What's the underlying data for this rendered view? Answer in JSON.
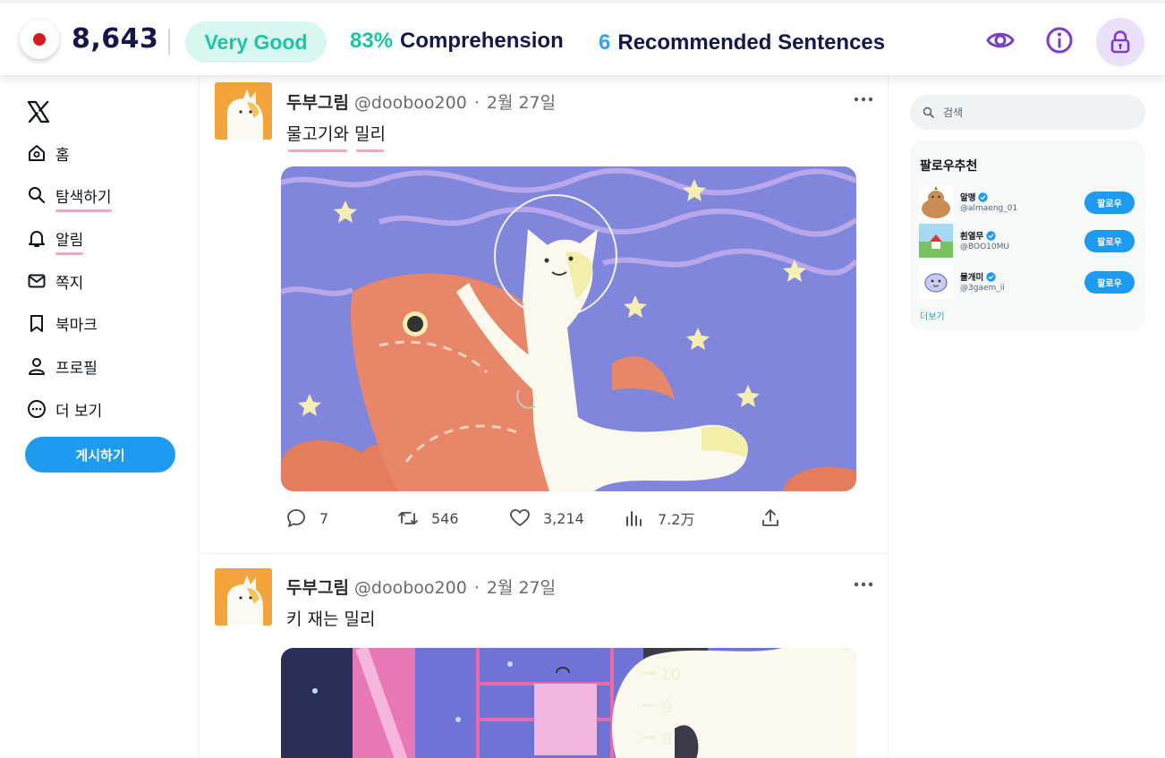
{
  "topbar": {
    "score": "8,643",
    "level": "Very Good",
    "comprehension_pct": "83%",
    "comprehension_label": "Comprehension",
    "recommended_count": "6",
    "recommended_label": "Recommended Sentences",
    "colors": {
      "accent_teal": "#1dc6a2",
      "navy": "#17154a",
      "purple": "#7b3fc4",
      "flag_red": "#d71920"
    },
    "icons": [
      "korea-flag-icon",
      "eye-icon",
      "info-icon",
      "lock-icon"
    ]
  },
  "sidebar": {
    "logo": "x-logo-icon",
    "items": [
      {
        "label": "홈",
        "icon": "home-icon"
      },
      {
        "label": "탐색하기",
        "icon": "search-icon"
      },
      {
        "label": "알림",
        "icon": "bell-icon"
      },
      {
        "label": "쪽지",
        "icon": "mail-icon"
      },
      {
        "label": "북마크",
        "icon": "bookmark-icon"
      },
      {
        "label": "프로필",
        "icon": "profile-icon"
      },
      {
        "label": "더 보기",
        "icon": "more-circle-icon"
      }
    ],
    "post_button": "게시하기"
  },
  "feed": {
    "tweets": [
      {
        "author": "두부그림",
        "handle": "@dooboo200",
        "dot": "·",
        "date": "2월 27일",
        "text_words": [
          "물고기와",
          "밀리"
        ],
        "replies": "7",
        "retweets": "546",
        "likes": "3,214",
        "views": "7.2万"
      },
      {
        "author": "두부그림",
        "handle": "@dooboo200",
        "dot": "·",
        "date": "2월 27일",
        "text": "키 재는 밀리",
        "ruler_marks": [
          "10",
          "9",
          "8"
        ]
      }
    ]
  },
  "right": {
    "search_placeholder": "검색",
    "who_to_follow": {
      "title": "팔로우추천",
      "accounts": [
        {
          "name": "알맹",
          "handle": "@almaeng_01",
          "button": "팔로우",
          "verified": true
        },
        {
          "name": "흰열무",
          "handle": "@BOO10MU",
          "button": "팔로우",
          "verified": true
        },
        {
          "name": "물개미",
          "handle": "@3gaem_ii",
          "button": "팔로우",
          "verified": true
        }
      ],
      "show_more": "더보기"
    }
  },
  "colors": {
    "x_blue": "#1d9bf0",
    "underline_pink": "#f0a6c4"
  }
}
